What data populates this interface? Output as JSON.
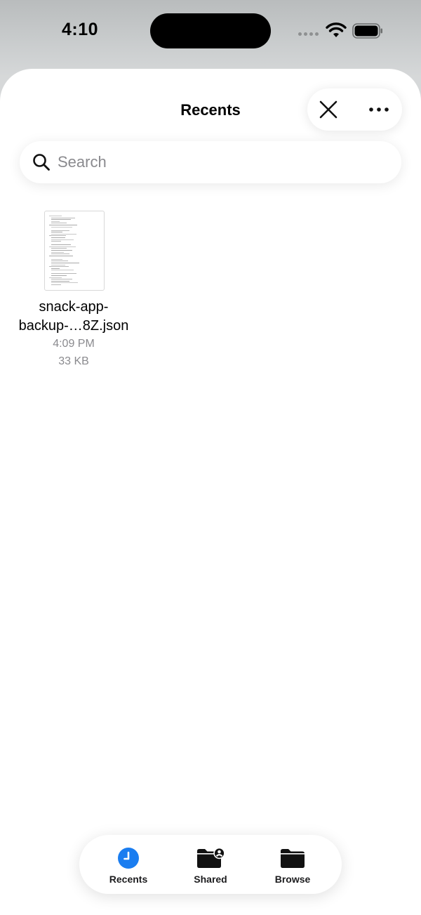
{
  "status_bar": {
    "time": "4:10"
  },
  "nav": {
    "title": "Recents",
    "close_icon": "close-icon",
    "more_icon": "ellipsis-icon"
  },
  "search": {
    "placeholder": "Search",
    "value": ""
  },
  "files": [
    {
      "name": "snack-app-backup-…8Z.json",
      "time": "4:09 PM",
      "size": "33 KB"
    }
  ],
  "tab_bar": {
    "tabs": [
      {
        "label": "Recents",
        "icon": "clock-icon",
        "active": true
      },
      {
        "label": "Shared",
        "icon": "shared-folder-icon",
        "active": false
      },
      {
        "label": "Browse",
        "icon": "folder-icon",
        "active": false
      }
    ]
  },
  "colors": {
    "accent": "#1a7df0",
    "secondary_text": "#8a8a8e"
  }
}
